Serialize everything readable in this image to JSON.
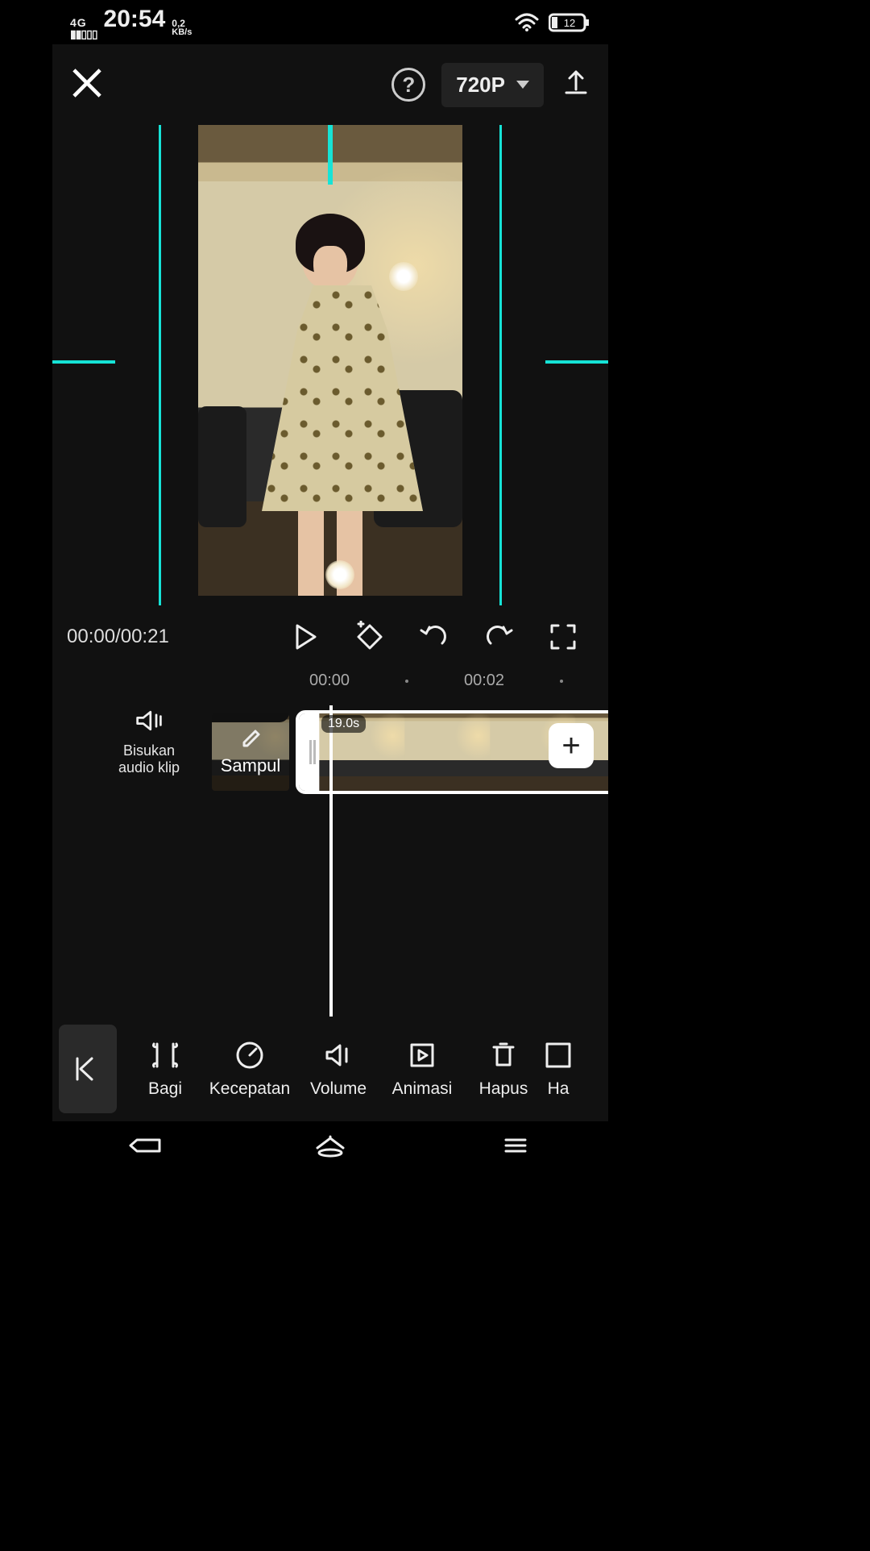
{
  "status_bar": {
    "network": "4G",
    "time": "20:54",
    "data_rate": "0,2",
    "data_rate_unit": "KB/s",
    "battery_pct": "12"
  },
  "header": {
    "resolution_label": "720P"
  },
  "playback": {
    "timecode": "00:00/00:21"
  },
  "timeline": {
    "ticks": [
      "00:00",
      "00:02"
    ],
    "clip_duration": "19.0s",
    "mute_label_l1": "Bisukan",
    "mute_label_l2": "audio klip",
    "cover_label": "Sampul"
  },
  "tools": {
    "items": [
      "Bagi",
      "Kecepatan",
      "Volume",
      "Animasi",
      "Hapus"
    ],
    "partial": "Ha"
  }
}
